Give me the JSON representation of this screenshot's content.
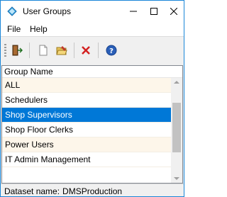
{
  "window": {
    "title": "User Groups",
    "app_icon": "diamond-app-icon"
  },
  "menu": {
    "items": [
      "File",
      "Help"
    ]
  },
  "toolbar": {
    "icons": [
      "exit-door-icon",
      "new-document-icon",
      "open-edit-icon",
      "delete-x-icon",
      "help-icon"
    ]
  },
  "grid": {
    "header": "Group Name",
    "rows": [
      "ALL",
      "Schedulers",
      "Shop Supervisors",
      "Shop Floor Clerks",
      "Power Users",
      "IT Admin Management"
    ],
    "selected": "Shop Supervisors"
  },
  "status": {
    "label": "Dataset name:",
    "value": "DMSProduction"
  },
  "colors": {
    "selection": "#0078d7",
    "alt_row": "#fdf6ea",
    "window_border": "#1a86d8"
  }
}
